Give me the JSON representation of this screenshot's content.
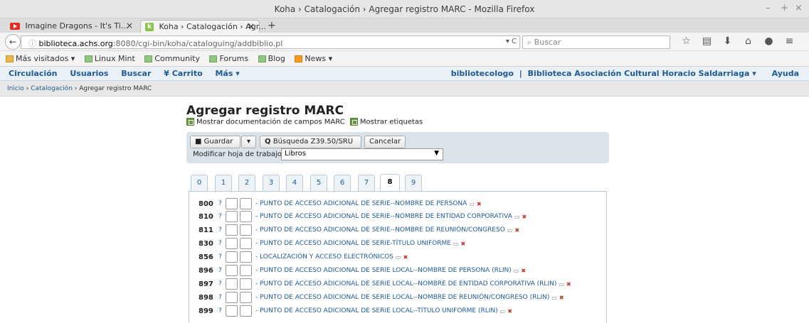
{
  "window": {
    "title": "Koha › Catalogación › Agregar registro MARC - Mozilla Firefox",
    "controls": [
      "–",
      "+",
      "×"
    ]
  },
  "tabs": [
    {
      "label": "Imagine Dragons - It's Ti...",
      "close": "×"
    },
    {
      "label": "Koha › Catalogación › Agr...",
      "close": "×"
    }
  ],
  "newtab": "+",
  "nav": {
    "back": "←",
    "url_host": "biblioteca.achs.org",
    "url_path": ":8080/cgi-bin/koha/cataloguing/addbiblio.pl",
    "url_ctrls": "▾ C",
    "search_placeholder": "Buscar",
    "icons": [
      "☆",
      "▤",
      "⬇",
      "⌂",
      "●",
      "≡"
    ]
  },
  "bookmarks": [
    "Más visitados ▾",
    "Linux Mint",
    "Community",
    "Forums",
    "Blog",
    "News ▾"
  ],
  "koha_nav": {
    "left": [
      "Circulación",
      "Usuarios",
      "Buscar",
      "¥ Carrito",
      "Más ▾"
    ],
    "user": "bibliotecologo",
    "separator": "|",
    "library": "Biblioteca Asociación Cultural Horacio Saldarriaga ▾",
    "help": "Ayuda"
  },
  "breadcrumb": {
    "home": "Inicio",
    "sep": " › ",
    "cataloging": "Catalogación",
    "current": "Agregar registro MARC"
  },
  "page": {
    "title": "Agregar registro MARC",
    "show_doc": "Mostrar documentación de campos MARC",
    "show_tags": "Mostrar etiquetas"
  },
  "toolbar": {
    "save": "Guardar",
    "save_icon": "■",
    "dropdown": "▾",
    "z3950": "Búsqueda Z39.50/SRU",
    "z3950_icon": "Q",
    "cancel": "Cancelar",
    "framework_label": "Modificar hoja de trabajo:",
    "framework_value": "Libros",
    "framework_caret": "▼"
  },
  "marc_tabs": [
    "0",
    "1",
    "2",
    "3",
    "4",
    "5",
    "6",
    "7",
    "8",
    "9"
  ],
  "marc_tab_selected": "8",
  "fields": [
    {
      "tag": "800",
      "desc": "- PUNTO DE ACCESO ADICIONAL DE SERIE--NOMBRE DE PERSONA"
    },
    {
      "tag": "810",
      "desc": "- PUNTO DE ACCESO ADICIONAL DE SERIE--NOMBRE DE ENTIDAD CORPORATIVA"
    },
    {
      "tag": "811",
      "desc": "- PUNTO DE ACCESO ADICIONAL DE SERIE--NOMBRE DE REUNIÓN/CONGRESO"
    },
    {
      "tag": "830",
      "desc": "- PUNTO DE ACCESO ADICIONAL DE SERIE-TÍTULO UNIFORME"
    },
    {
      "tag": "856",
      "desc": "- LOCALIZACIÓN Y ACCESO ELECTRÓNICOS"
    },
    {
      "tag": "896",
      "desc": "- PUNTO DE ACCESO ADICIONAL DE SERIE LOCAL--NOMBRE DE PERSONA (RLIN)"
    },
    {
      "tag": "897",
      "desc": "- PUNTO DE ACCESO ADICIONAL DE SERIE LOCAL--NOMBRE DE ENTIDAD CORPORATIVA (RLIN)"
    },
    {
      "tag": "898",
      "desc": "- PUNTO DE ACCESO ADICIONAL DE SERIE LOCAL--NOMBRE DE REUNIÓN/CONGRESO (RLIN)"
    },
    {
      "tag": "899",
      "desc": "- PUNTO DE ACCESO ADICIONAL DE SERIE LOCAL--TÍTULO UNIFORME (RLIN)"
    }
  ],
  "field_help": "?",
  "icons": {
    "clone": "▭",
    "delete": "✖"
  }
}
